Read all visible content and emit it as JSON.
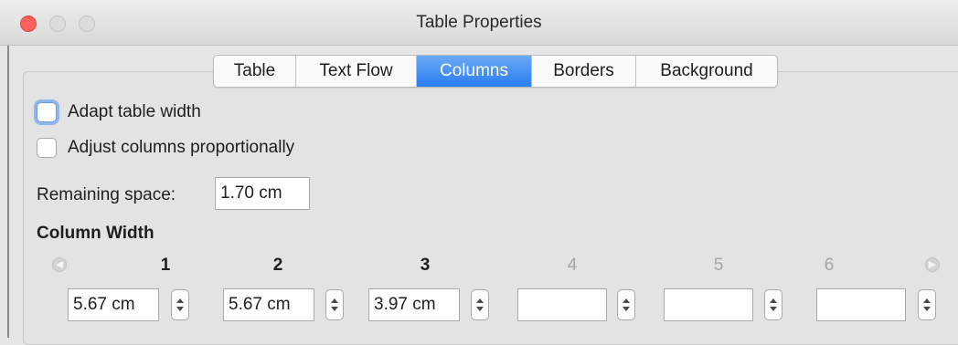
{
  "window": {
    "title": "Table Properties"
  },
  "tabs": [
    {
      "label": "Table",
      "active": false
    },
    {
      "label": "Text Flow",
      "active": false
    },
    {
      "label": "Columns",
      "active": true
    },
    {
      "label": "Borders",
      "active": false
    },
    {
      "label": "Background",
      "active": false
    }
  ],
  "options": {
    "adapt_table_width": {
      "label": "Adapt table width",
      "checked": false
    },
    "adjust_columns_proportionally": {
      "label": "Adjust columns proportionally",
      "checked": false
    }
  },
  "remaining_space": {
    "label": "Remaining space:",
    "value": "1.70 cm"
  },
  "column_width": {
    "heading": "Column Width",
    "columns": [
      {
        "number": "1",
        "value": "5.67 cm",
        "enabled": true
      },
      {
        "number": "2",
        "value": "5.67 cm",
        "enabled": true
      },
      {
        "number": "3",
        "value": "3.97 cm",
        "enabled": true
      },
      {
        "number": "4",
        "value": "",
        "enabled": false
      },
      {
        "number": "5",
        "value": "",
        "enabled": false
      },
      {
        "number": "6",
        "value": "",
        "enabled": false
      }
    ]
  },
  "colors": {
    "active_tab": "#2b7df2",
    "close_button": "#fc605c"
  }
}
